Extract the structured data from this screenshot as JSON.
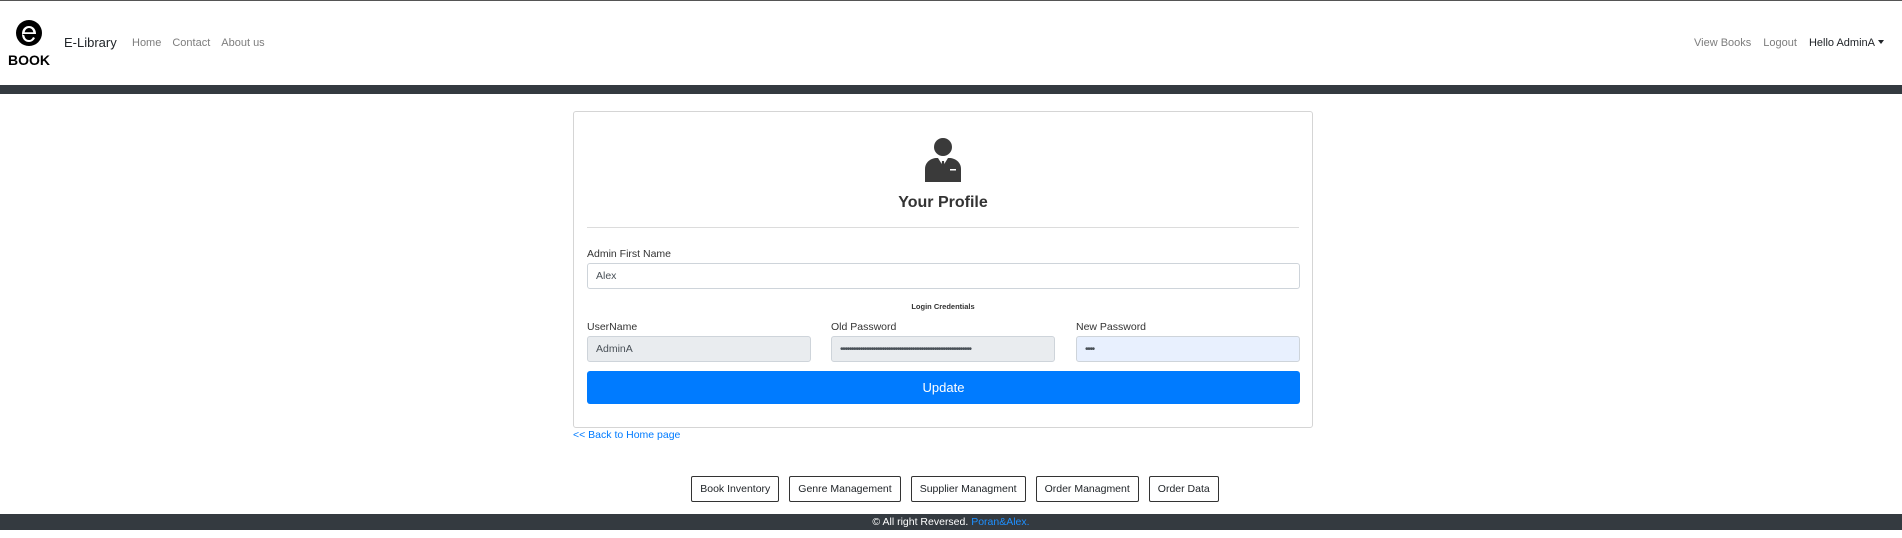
{
  "navbar": {
    "logo_text": "e BOOK",
    "brand": "E-Library",
    "links": [
      "Home",
      "Contact",
      "About us"
    ],
    "right_links": [
      "View Books",
      "Logout"
    ],
    "user_menu": "Hello AdminA"
  },
  "profile": {
    "title": "Your Profile",
    "first_name_label": "Admin First Name",
    "first_name_value": "Alex",
    "credentials_title": "Login Credentials",
    "username_label": "UserName",
    "username_value": "AdminA",
    "old_password_label": "Old Password",
    "old_password_value": "••••••••••••••••••••••••••••••••••••••••••••••••••••••••••••",
    "new_password_label": "New Password",
    "new_password_value": "••••",
    "update_button": "Update"
  },
  "back_link": "<< Back to Home page",
  "admin_buttons": [
    "Book Inventory",
    "Genre Management",
    "Supplier Managment",
    "Order Managment",
    "Order Data"
  ],
  "footer": {
    "text": "© All right Reversed.",
    "link": "Poran&Alex."
  },
  "colors": {
    "primary": "#007bff",
    "dark_bar": "#343a40",
    "autofill_bg": "#e8f0fe",
    "readonly_bg": "#e9ecef"
  }
}
